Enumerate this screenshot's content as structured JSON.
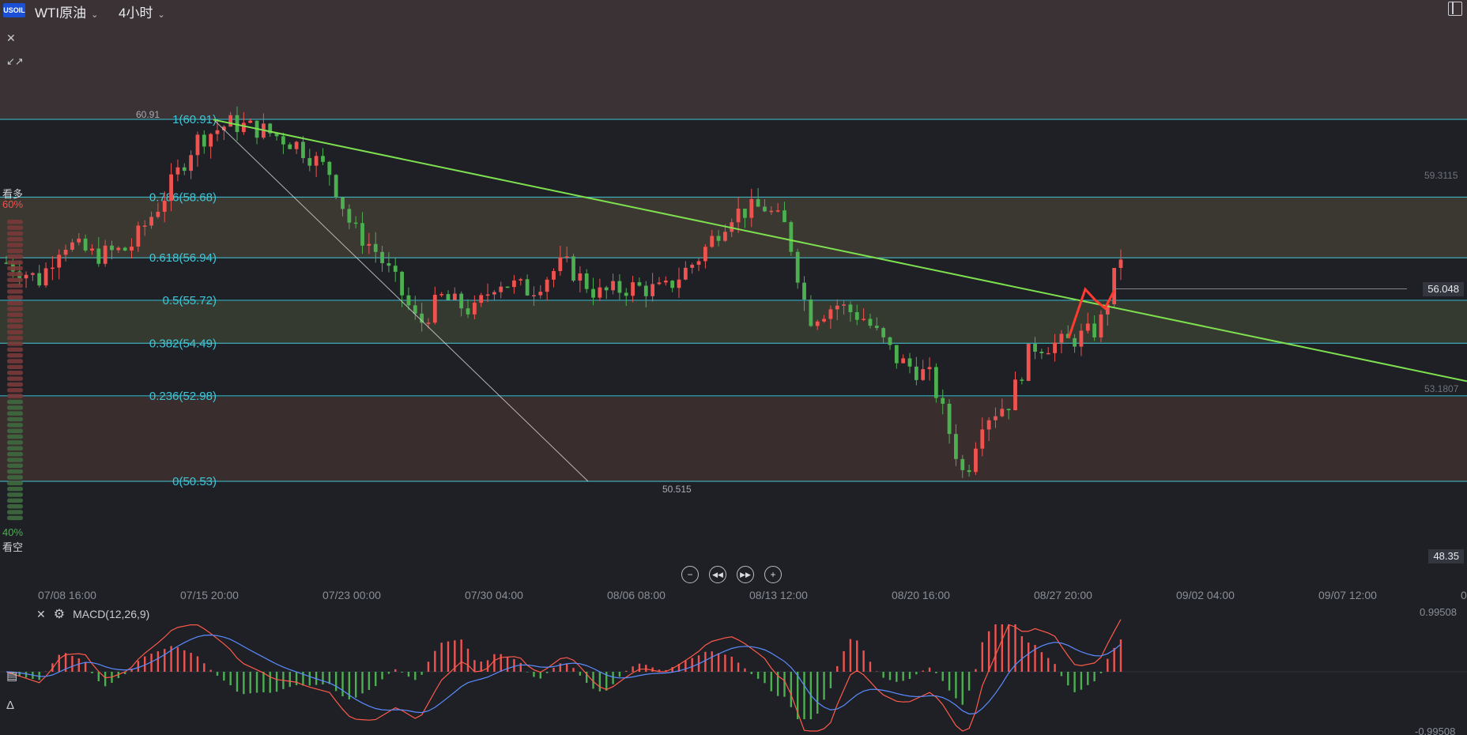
{
  "header": {
    "logo_text": "USOIL",
    "symbol": "WTI原油",
    "timeframe": "4小时"
  },
  "sentiment": {
    "bull_label": "看多",
    "bull_pct": "60%",
    "bear_label": "看空",
    "bear_pct": "40%",
    "bull_value": 0.6
  },
  "prices": {
    "current": "56.048",
    "low_axis": "48.35",
    "axis_upper": "59.3115",
    "axis_lower": "53.1807",
    "high_mark": "60.91",
    "low_mark": "50.515"
  },
  "macd": {
    "label": "MACD(12,26,9)",
    "axis_top": "0.99508",
    "axis_bottom": "-0.99508"
  },
  "colors": {
    "up": "#ef5350",
    "down": "#4caf50",
    "fib_line": "#3fc6d6",
    "trend": "#7ee04f",
    "dif": "#5b8cff",
    "dea": "#ff5a4a"
  },
  "icons": {
    "close": "close-icon",
    "collapse": "collapse-icon",
    "zoom_out": "zoom-out-icon",
    "jump_start": "jump-start-icon",
    "jump_end": "jump-end-icon",
    "zoom_in": "zoom-in-icon",
    "gear": "gear-icon",
    "layout": "layout-icon"
  },
  "chart_data": {
    "type": "candlestick",
    "x_ticks": [
      "07/08 16:00",
      "07/15 20:00",
      "07/23 00:00",
      "07/30 04:00",
      "08/06 08:00",
      "08/13 12:00",
      "08/20 16:00",
      "08/27 20:00",
      "09/02 04:00",
      "09/07 12:00",
      "0"
    ],
    "ylim": [
      48.0,
      63.5
    ],
    "fib_levels": [
      {
        "ratio": "1",
        "price": 60.91,
        "label": "1(60.91)"
      },
      {
        "ratio": "0.786",
        "price": 58.68,
        "label": "0.786(58.68)"
      },
      {
        "ratio": "0.618",
        "price": 56.94,
        "label": "0.618(56.94)"
      },
      {
        "ratio": "0.5",
        "price": 55.72,
        "label": "0.5(55.72)"
      },
      {
        "ratio": "0.382",
        "price": 54.49,
        "label": "0.382(54.49)"
      },
      {
        "ratio": "0.236",
        "price": 52.98,
        "label": "0.236(52.98)"
      },
      {
        "ratio": "0",
        "price": 50.53,
        "label": "0(50.53)"
      }
    ],
    "close_path": [
      {
        "t": 0,
        "p": 56.8
      },
      {
        "t": 0.03,
        "p": 56.3
      },
      {
        "t": 0.05,
        "p": 57.4
      },
      {
        "t": 0.08,
        "p": 57.0
      },
      {
        "t": 0.11,
        "p": 57.2
      },
      {
        "t": 0.14,
        "p": 58.6
      },
      {
        "t": 0.17,
        "p": 60.3
      },
      {
        "t": 0.2,
        "p": 60.8
      },
      {
        "t": 0.23,
        "p": 60.6
      },
      {
        "t": 0.26,
        "p": 60.2
      },
      {
        "t": 0.29,
        "p": 59.4
      },
      {
        "t": 0.31,
        "p": 57.8
      },
      {
        "t": 0.33,
        "p": 57.2
      },
      {
        "t": 0.35,
        "p": 56.2
      },
      {
        "t": 0.37,
        "p": 55.0
      },
      {
        "t": 0.39,
        "p": 55.8
      },
      {
        "t": 0.42,
        "p": 55.4
      },
      {
        "t": 0.44,
        "p": 56.3
      },
      {
        "t": 0.47,
        "p": 56.0
      },
      {
        "t": 0.5,
        "p": 56.8
      },
      {
        "t": 0.53,
        "p": 55.9
      },
      {
        "t": 0.56,
        "p": 56.1
      },
      {
        "t": 0.59,
        "p": 56.0
      },
      {
        "t": 0.62,
        "p": 56.9
      },
      {
        "t": 0.65,
        "p": 58.2
      },
      {
        "t": 0.68,
        "p": 58.4
      },
      {
        "t": 0.7,
        "p": 57.8
      },
      {
        "t": 0.72,
        "p": 55.2
      },
      {
        "t": 0.745,
        "p": 55.6
      },
      {
        "t": 0.77,
        "p": 55.2
      },
      {
        "t": 0.8,
        "p": 54.0
      },
      {
        "t": 0.83,
        "p": 53.5
      },
      {
        "t": 0.86,
        "p": 50.6
      },
      {
        "t": 0.875,
        "p": 52.3
      },
      {
        "t": 0.9,
        "p": 52.8
      },
      {
        "t": 0.92,
        "p": 54.4
      },
      {
        "t": 0.95,
        "p": 54.5
      },
      {
        "t": 0.98,
        "p": 54.9
      },
      {
        "t": 1.0,
        "p": 57.0
      }
    ],
    "trendline": {
      "start": 60.9,
      "end": 53.4
    },
    "series": [
      {
        "name": "DIF",
        "values": []
      },
      {
        "name": "DEA",
        "values": []
      }
    ]
  }
}
